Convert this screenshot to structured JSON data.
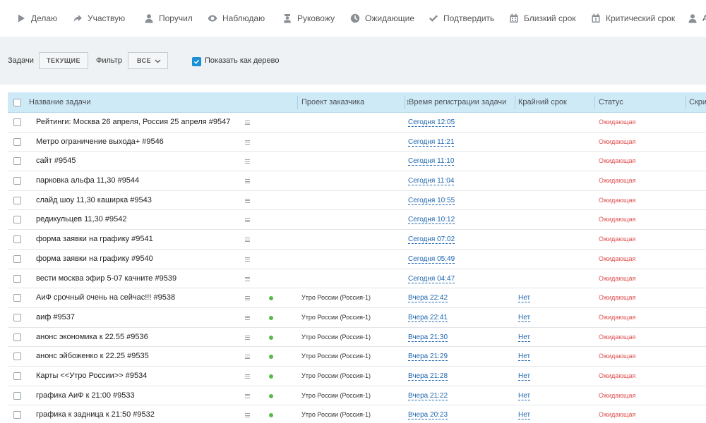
{
  "tabs": [
    {
      "icon": "play-icon",
      "label": "Делаю"
    },
    {
      "icon": "share-icon",
      "label": "Участвую"
    },
    {
      "icon": "user-icon",
      "label": "Поручил"
    },
    {
      "icon": "eye-icon",
      "label": "Наблюдаю"
    },
    {
      "icon": "boss-icon",
      "label": "Руковожу"
    },
    {
      "icon": "clock-icon",
      "label": "Ожидающие"
    },
    {
      "icon": "check-icon",
      "label": "Подтвердить"
    },
    {
      "icon": "calendar-icon",
      "label": "Близкий срок"
    },
    {
      "icon": "calendar-alert-icon",
      "label": "Критический срок"
    },
    {
      "icon": "user-icon",
      "label": "Ан"
    }
  ],
  "filters": {
    "tasks_label": "Задачи",
    "tasks_value": "ТЕКУЩИЕ",
    "filter_label": "Фильтр",
    "filter_value": "ВСЕ",
    "tree_label": "Показать как дерево",
    "tree_checked": true
  },
  "table": {
    "headers": {
      "name": "Название задачи",
      "project": "Проект заказчика",
      "registered": "Время регистрации задачи",
      "deadline": "Крайний срок",
      "status": "Статус",
      "extra": "Скри"
    },
    "rows": [
      {
        "name": "Рейтинги: Москва 26 апреля, Россия 25 апреля #9547",
        "dot": false,
        "project": "",
        "registered": "Сегодня 12:05",
        "deadline": "",
        "status": "Ожидающая"
      },
      {
        "name": "Метро ограничение выхода+ #9546",
        "dot": false,
        "project": "",
        "registered": "Сегодня 11:21",
        "deadline": "",
        "status": "Ожидающая"
      },
      {
        "name": "сайт #9545",
        "dot": false,
        "project": "",
        "registered": "Сегодня 11:10",
        "deadline": "",
        "status": "Ожидающая"
      },
      {
        "name": "парковка альфа 11,30 #9544",
        "dot": false,
        "project": "",
        "registered": "Сегодня 11:04",
        "deadline": "",
        "status": "Ожидающая"
      },
      {
        "name": "слайд шоу 11,30 каширка #9543",
        "dot": false,
        "project": "",
        "registered": "Сегодня 10:55",
        "deadline": "",
        "status": "Ожидающая"
      },
      {
        "name": "редикульцев 11,30 #9542",
        "dot": false,
        "project": "",
        "registered": "Сегодня 10:12",
        "deadline": "",
        "status": "Ожидающая"
      },
      {
        "name": "форма заявки на графику #9541",
        "dot": false,
        "project": "",
        "registered": "Сегодня 07:02",
        "deadline": "",
        "status": "Ожидающая"
      },
      {
        "name": "форма заявки на графику #9540",
        "dot": false,
        "project": "",
        "registered": "Сегодня 05:49",
        "deadline": "",
        "status": "Ожидающая"
      },
      {
        "name": "вести москва эфир 5-07 качните #9539",
        "dot": false,
        "project": "",
        "registered": "Сегодня 04:47",
        "deadline": "",
        "status": "Ожидающая"
      },
      {
        "name": "АиФ срочный очень на сейчас!!! #9538",
        "dot": true,
        "project": "Утро России (Россия-1)",
        "registered": "Вчера 22:42",
        "deadline": "Нет",
        "status": "Ожидающая"
      },
      {
        "name": "аиф #9537",
        "dot": true,
        "project": "Утро России (Россия-1)",
        "registered": "Вчера 22:41",
        "deadline": "Нет",
        "status": "Ожидающая"
      },
      {
        "name": "анонс экономика к 22.55 #9536",
        "dot": true,
        "project": "Утро России (Россия-1)",
        "registered": "Вчера 21:30",
        "deadline": "Нет",
        "status": "Ожидающая"
      },
      {
        "name": "анонс эйбоженко к 22.25 #9535",
        "dot": true,
        "project": "Утро России (Россия-1)",
        "registered": "Вчера 21:29",
        "deadline": "Нет",
        "status": "Ожидающая"
      },
      {
        "name": "Карты <<Утро России>> #9534",
        "dot": true,
        "project": "Утро России (Россия-1)",
        "registered": "Вчера 21:28",
        "deadline": "Нет",
        "status": "Ожидающая"
      },
      {
        "name": "графика АиФ к 21:00 #9533",
        "dot": true,
        "project": "Утро России (Россия-1)",
        "registered": "Вчера 21:22",
        "deadline": "Нет",
        "status": "Ожидающая"
      },
      {
        "name": "графика к задница к 21:50 #9532",
        "dot": true,
        "project": "Утро России (Россия-1)",
        "registered": "Вчера 20:23",
        "deadline": "Нет",
        "status": "Ожидающая"
      }
    ]
  },
  "colors": {
    "accent": "#1a8fd4",
    "header_bg": "#cfeaf7",
    "filter_bg": "#eef2f4",
    "status_waiting": "#e05050",
    "link": "#2067b0",
    "dot_green": "#5ab94b"
  }
}
